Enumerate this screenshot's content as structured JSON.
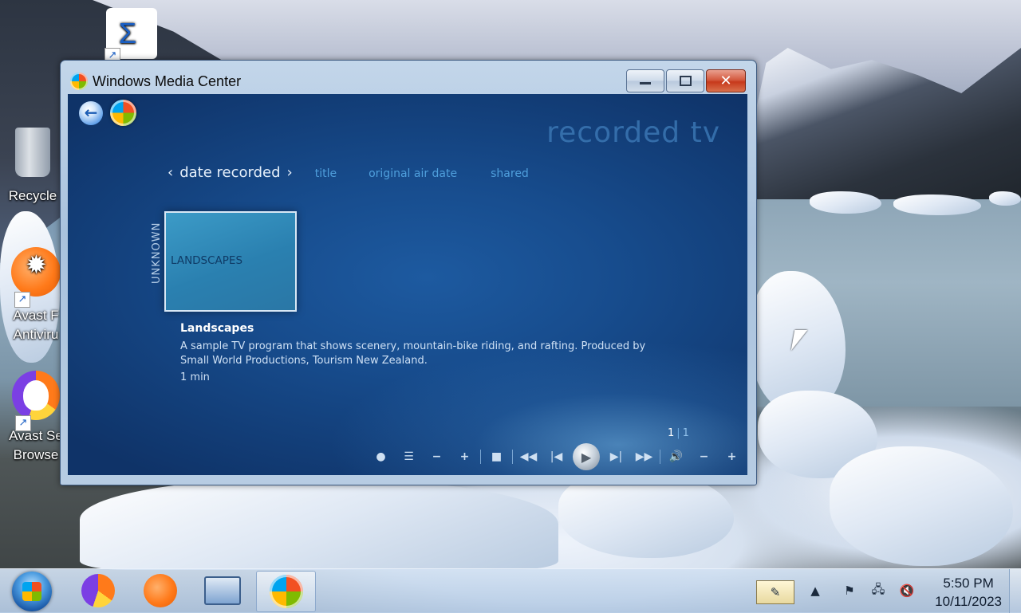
{
  "window": {
    "title": "Windows Media Center",
    "minimize_icon": "minimize-icon",
    "maximize_icon": "maximize-icon",
    "close_icon": "close-icon"
  },
  "media_center": {
    "section_title": "recorded tv",
    "pivots": {
      "active": "date recorded",
      "prev_glyph": "‹",
      "next_glyph": "›",
      "others": [
        "title",
        "original air date",
        "shared"
      ]
    },
    "group_label": "UNKNOWN",
    "tile_label": "LANDSCAPES",
    "program": {
      "title": "Landscapes",
      "description": "A sample TV program that shows scenery, mountain-bike riding, and rafting. Produced by Small World Productions, Tourism New Zealand.",
      "duration": "1 min"
    },
    "pager": {
      "current": "1",
      "total": "1"
    },
    "transport_icons": [
      "record-icon",
      "guide-icon",
      "channel-down-icon",
      "channel-up-icon",
      "stop-icon",
      "rewind-icon",
      "skip-back-icon",
      "play-icon",
      "skip-forward-icon",
      "fast-forward-icon",
      "volume-icon",
      "volume-down-icon",
      "volume-up-icon"
    ]
  },
  "desktop": {
    "icons": [
      {
        "label": "",
        "icon": "shortcut-icon"
      },
      {
        "label": "Recycle",
        "icon": "recycle-bin-icon"
      },
      {
        "label": "Avast F\nAntiviru",
        "icon": "avast-antivirus-icon"
      },
      {
        "label": "Avast Se\nBrowse",
        "icon": "avast-browser-icon"
      }
    ]
  },
  "taskbar": {
    "apps": [
      "avast-browser-icon",
      "avast-antivirus-icon",
      "on-screen-keyboard-icon",
      "media-center-icon"
    ],
    "tray_icons": [
      "pen-tablet-icon",
      "show-hidden-icons-icon",
      "action-center-icon",
      "network-icon",
      "volume-muted-icon"
    ],
    "time": "5:50 PM",
    "date": "10/11/2023"
  },
  "colors": {
    "mc_background": "#174c8d",
    "accent_blue": "#4f9fdc",
    "close_red": "#c7391c"
  }
}
